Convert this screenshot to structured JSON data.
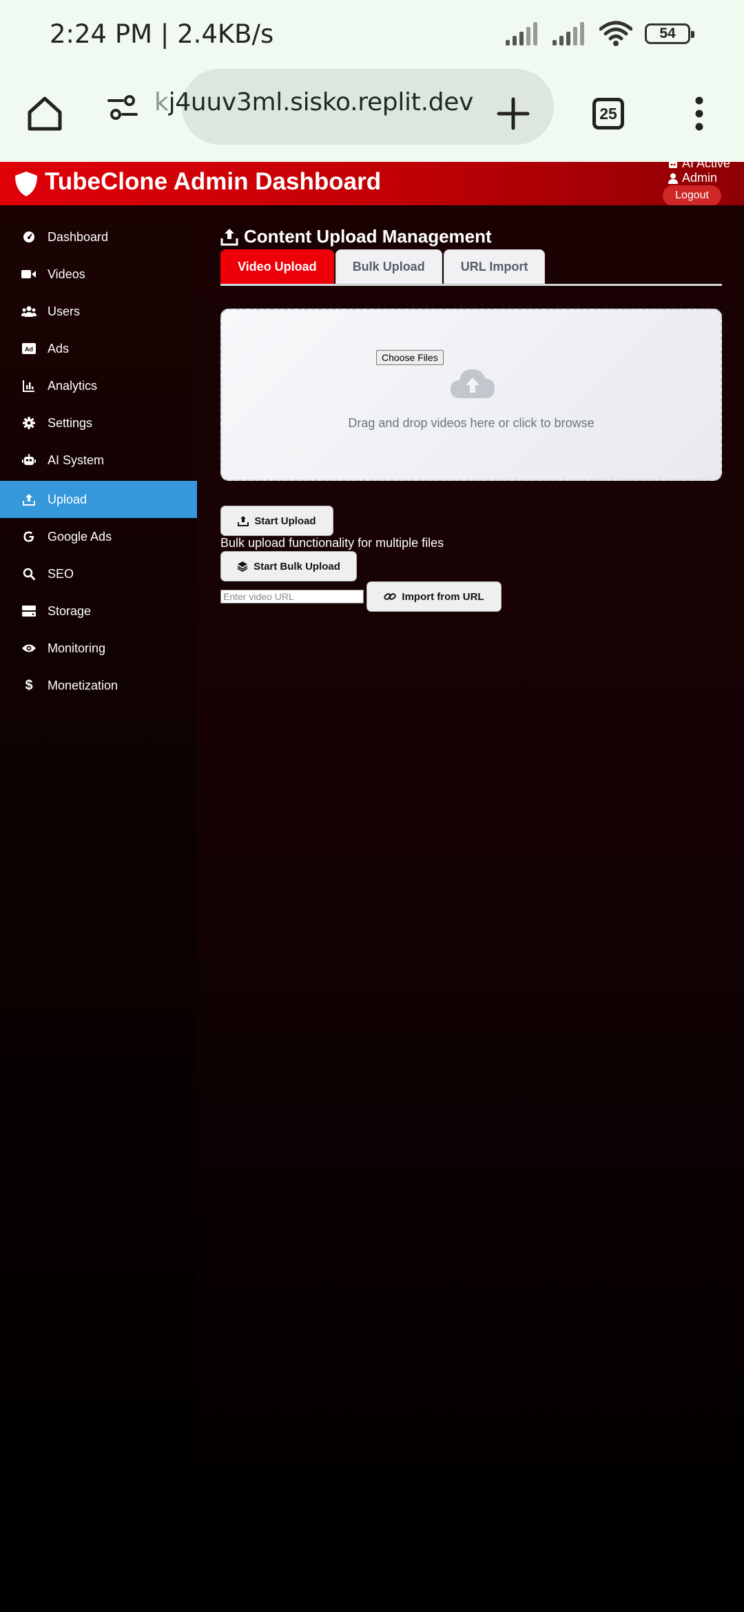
{
  "status_bar": {
    "time": "2:24 PM | 2.4KB/s",
    "battery": "54"
  },
  "browser": {
    "url_faded": "k",
    "url": "j4uuv3ml.sisko.replit.dev",
    "tab_count": "25"
  },
  "header": {
    "title": "TubeClone Admin Dashboard",
    "ai_status": "AI Active",
    "user": "Admin",
    "logout": "Logout",
    "accent_color": "#e00008"
  },
  "sidebar": {
    "items": [
      {
        "label": "Dashboard",
        "icon": "gauge-icon"
      },
      {
        "label": "Videos",
        "icon": "video-icon"
      },
      {
        "label": "Users",
        "icon": "users-icon"
      },
      {
        "label": "Ads",
        "icon": "ad-icon"
      },
      {
        "label": "Analytics",
        "icon": "chart-icon"
      },
      {
        "label": "Settings",
        "icon": "gear-icon"
      },
      {
        "label": "AI System",
        "icon": "robot-icon"
      },
      {
        "label": "Upload",
        "icon": "upload-icon",
        "active": true
      },
      {
        "label": "Google Ads",
        "icon": "google-icon"
      },
      {
        "label": "SEO",
        "icon": "search-icon"
      },
      {
        "label": "Storage",
        "icon": "hdd-icon"
      },
      {
        "label": "Monitoring",
        "icon": "eye-icon"
      },
      {
        "label": "Monetization",
        "icon": "dollar-icon"
      }
    ],
    "active_color": "#3498db"
  },
  "main": {
    "section_title": "Content Upload Management",
    "tabs": [
      {
        "label": "Video Upload",
        "active": true
      },
      {
        "label": "Bulk Upload"
      },
      {
        "label": "URL Import"
      }
    ],
    "dropzone": {
      "choose_files": "Choose Files",
      "text": "Drag and drop videos here or click to browse"
    },
    "start_upload": "Start Upload",
    "bulk_text": "Bulk upload functionality for multiple files",
    "start_bulk_upload": "Start Bulk Upload",
    "url_placeholder": "Enter video URL",
    "import_from_url": "Import from URL"
  }
}
